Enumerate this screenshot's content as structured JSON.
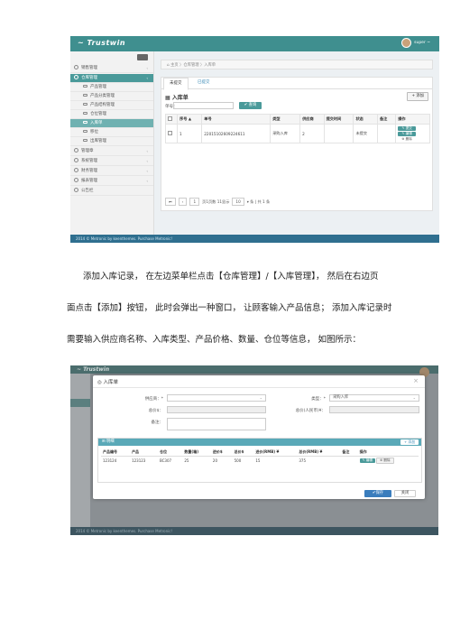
{
  "shot1": {
    "brand": "~ Trustwin",
    "user_name": "super ~",
    "sidebar": [
      {
        "label": "销售管理",
        "arrow": "‹"
      },
      {
        "label": "仓库管理",
        "arrow": "‹"
      },
      {
        "label": "产品管理"
      },
      {
        "label": "产品分类管理"
      },
      {
        "label": "产品结构管理"
      },
      {
        "label": "仓位管理"
      },
      {
        "label": "入库单"
      },
      {
        "label": "移位"
      },
      {
        "label": "出库管理"
      },
      {
        "label": "管理章",
        "arrow": "‹"
      },
      {
        "label": "系统管理",
        "arrow": "‹"
      },
      {
        "label": "财务管理",
        "arrow": "‹"
      },
      {
        "label": "报表管理",
        "arrow": "‹"
      },
      {
        "label": "公告栏"
      }
    ],
    "breadcrumb": "⌂ 主页 〉仓库管理 〉入库单",
    "tabs": [
      "未提交",
      "已提交"
    ],
    "panel_title": "入库单",
    "add_label": "+ 添加",
    "search_label": "单号：",
    "search_btn": "✔ 查询",
    "table": {
      "headers": [
        "",
        "序号 ▲",
        "单号",
        "类型",
        "供应商",
        "提交时间",
        "状态",
        "备注",
        "操作"
      ],
      "rows": [
        [
          "",
          "1",
          "22015102609224611",
          "采购入库",
          "2",
          "",
          "未提交",
          "",
          ""
        ]
      ],
      "ops": [
        "✎ 提交",
        "✎ 编辑",
        "⊗ 删除"
      ]
    },
    "pager": {
      "first": "⏮",
      "prev": "‹",
      "page": "1",
      "of": "页1页数 11显示",
      "size": "10",
      "total": "▾ 条 | 共 1 条"
    },
    "footer": "2014 © Metronic by keenthemes. Purchase Metronic!"
  },
  "paragraph": {
    "line1": "添加入库记录， 在左边菜单栏点击【仓库管理】/【入库管理】， 然后在右边页",
    "line2": "面点击【添加】按钮， 此时会弹出一种窗口， 让顾客输入产品信息； 添加入库记录时",
    "line3": "需要输入供应商名称、入库类型、产品价格、数量、仓位等信息， 如图所示："
  },
  "shot2": {
    "bg_brand": "~ Trustwin",
    "bg_footer": "2014 © Metronic by keenthemes. Purchase Metronic!",
    "modal_title": "◎ 入库单",
    "close": "×",
    "fields": {
      "supplier_label": "供应商：*",
      "type_label": "类型：*",
      "type_value": "采购入库",
      "total_label": "总价$：",
      "total_rmb_label": "总价(人民币)¥：",
      "note_label": "备注："
    },
    "detail_title": "⊞ 明细",
    "detail_add": "+ 添加",
    "detail_table": {
      "headers": [
        "产品编号",
        "产品",
        "仓位",
        "数量(箱)",
        "进价$",
        "总价$",
        "进价(RMB) ¥",
        "总价(RMB) ¥",
        "备注",
        "操作"
      ],
      "rows": [
        [
          "123124",
          "123123",
          "BC307",
          "25",
          "20",
          "500",
          "15",
          "375",
          ""
        ]
      ],
      "edit": "✎ 编辑",
      "delete": "⊗ 删除"
    },
    "save": "✔保存",
    "close_btn": "关闭"
  }
}
